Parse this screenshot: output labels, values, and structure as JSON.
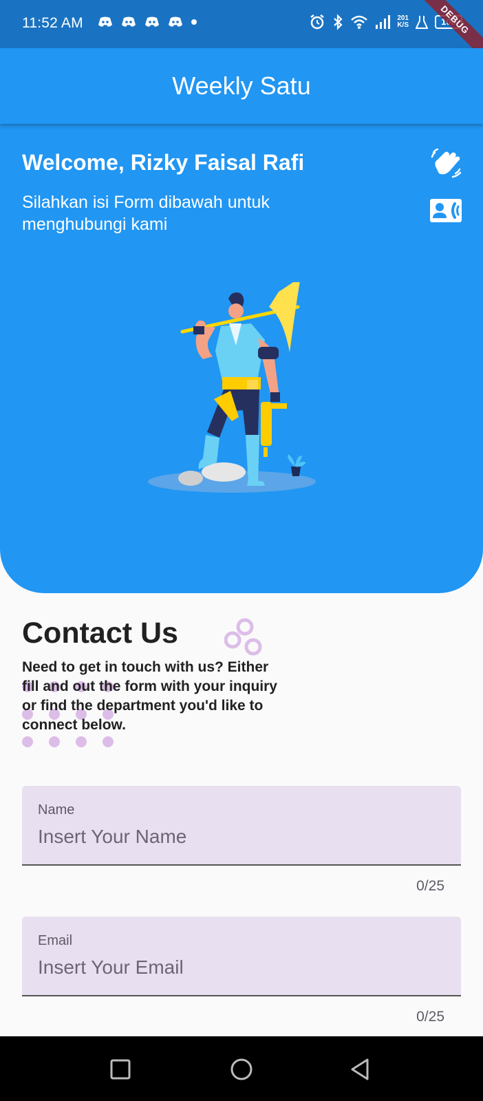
{
  "status_bar": {
    "time": "11:52 AM",
    "net_speed_value": "201",
    "net_speed_unit": "K/S",
    "battery": "100",
    "debug_label": "DEBUG",
    "icons": [
      "discord-icon",
      "discord-icon",
      "discord-icon",
      "discord-icon",
      "dot-icon",
      "alarm-icon",
      "bluetooth-icon",
      "wifi-icon",
      "signal-icon",
      "flask-icon",
      "battery-icon"
    ]
  },
  "app_bar": {
    "title": "Weekly Satu"
  },
  "hero": {
    "welcome": "Welcome, Rizky Faisal Rafi",
    "subtitle": "Silahkan isi Form dibawah untuk menghubungi kami",
    "icons": [
      "waving-hand-icon",
      "contact-card-icon"
    ],
    "illustration": "miner-with-pickaxe-illustration"
  },
  "contact": {
    "title": "Contact Us",
    "description": "Need to get in touch with us? Either fill and out the form with your inquiry or find the department you'd like to connect below."
  },
  "form": {
    "fields": [
      {
        "label": "Name",
        "placeholder": "Insert Your Name",
        "value": "",
        "counter": "0/25"
      },
      {
        "label": "Email",
        "placeholder": "Insert Your Email",
        "value": "",
        "counter": "0/25"
      }
    ]
  },
  "nav_bar": {
    "icons": [
      "recents-square-icon",
      "home-circle-icon",
      "back-triangle-icon"
    ]
  },
  "colors": {
    "primary": "#2196f3",
    "status_bar": "#1a73c2",
    "field_fill": "#e8dff0",
    "decoration": "#dcbde8"
  }
}
